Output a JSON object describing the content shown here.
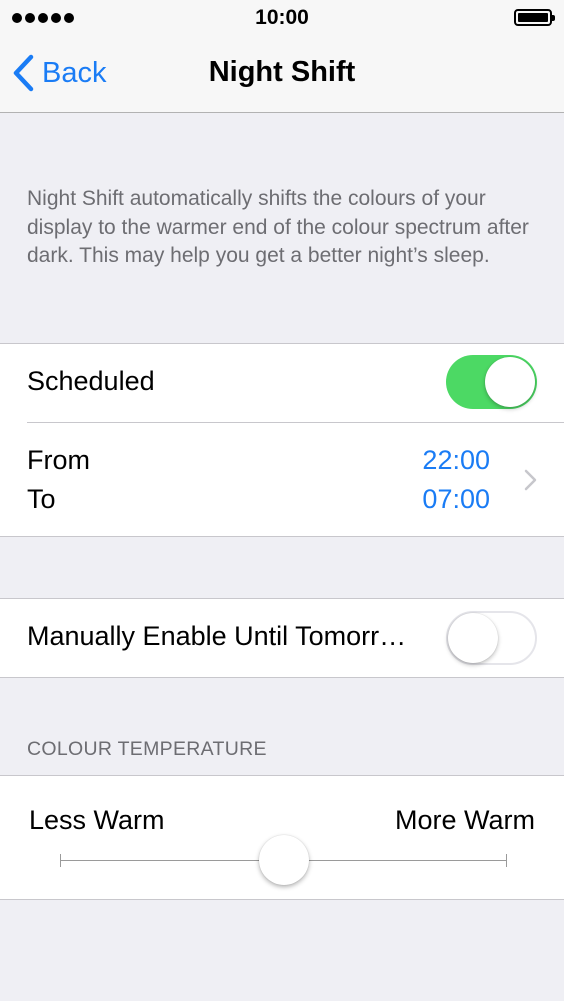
{
  "status_bar": {
    "time": "10:00",
    "signal_dots": 5,
    "battery_level": 1.0
  },
  "nav": {
    "back_label": "Back",
    "title": "Night Shift"
  },
  "description": "Night Shift automatically shifts the colours of your display to the warmer end of the colour spectrum after dark. This may help you get a better night’s sleep.",
  "schedule": {
    "scheduled_label": "Scheduled",
    "scheduled_on": true,
    "from_label": "From",
    "to_label": "To",
    "from_time": "22:00",
    "to_time": "07:00"
  },
  "manual": {
    "label": "Manually Enable Until Tomorr…",
    "on": false
  },
  "temperature": {
    "header": "COLOUR TEMPERATURE",
    "min_label": "Less Warm",
    "max_label": "More Warm",
    "value": 0.5
  },
  "colors": {
    "accent": "#1a7cf5",
    "toggle_on": "#4cd964",
    "background": "#efeff4"
  }
}
